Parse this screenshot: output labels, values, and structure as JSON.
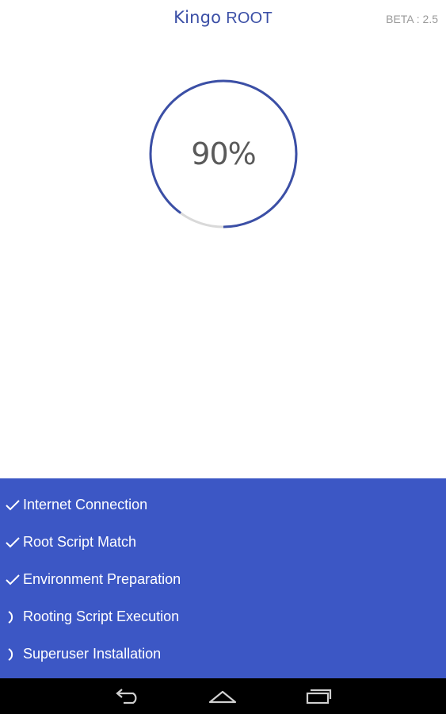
{
  "header": {
    "title_brand": "Kingo",
    "title_root": "ROOT",
    "version": "BETA : 2.5"
  },
  "progress": {
    "value": 0.9,
    "label": "90%"
  },
  "steps": [
    {
      "label": "Internet Connection",
      "status": "done"
    },
    {
      "label": "Root Script Match",
      "status": "done"
    },
    {
      "label": "Environment Preparation",
      "status": "done"
    },
    {
      "label": "Rooting Script Execution",
      "status": "pending"
    },
    {
      "label": "Superuser Installation",
      "status": "pending"
    }
  ],
  "colors": {
    "accent": "#3c57c5",
    "ring_track": "#d9d9d9",
    "ring_fill": "#3b4fa6",
    "nav_bar": "#000000"
  },
  "nav": {
    "icons": [
      "back-icon",
      "home-icon",
      "recent-apps-icon"
    ]
  }
}
